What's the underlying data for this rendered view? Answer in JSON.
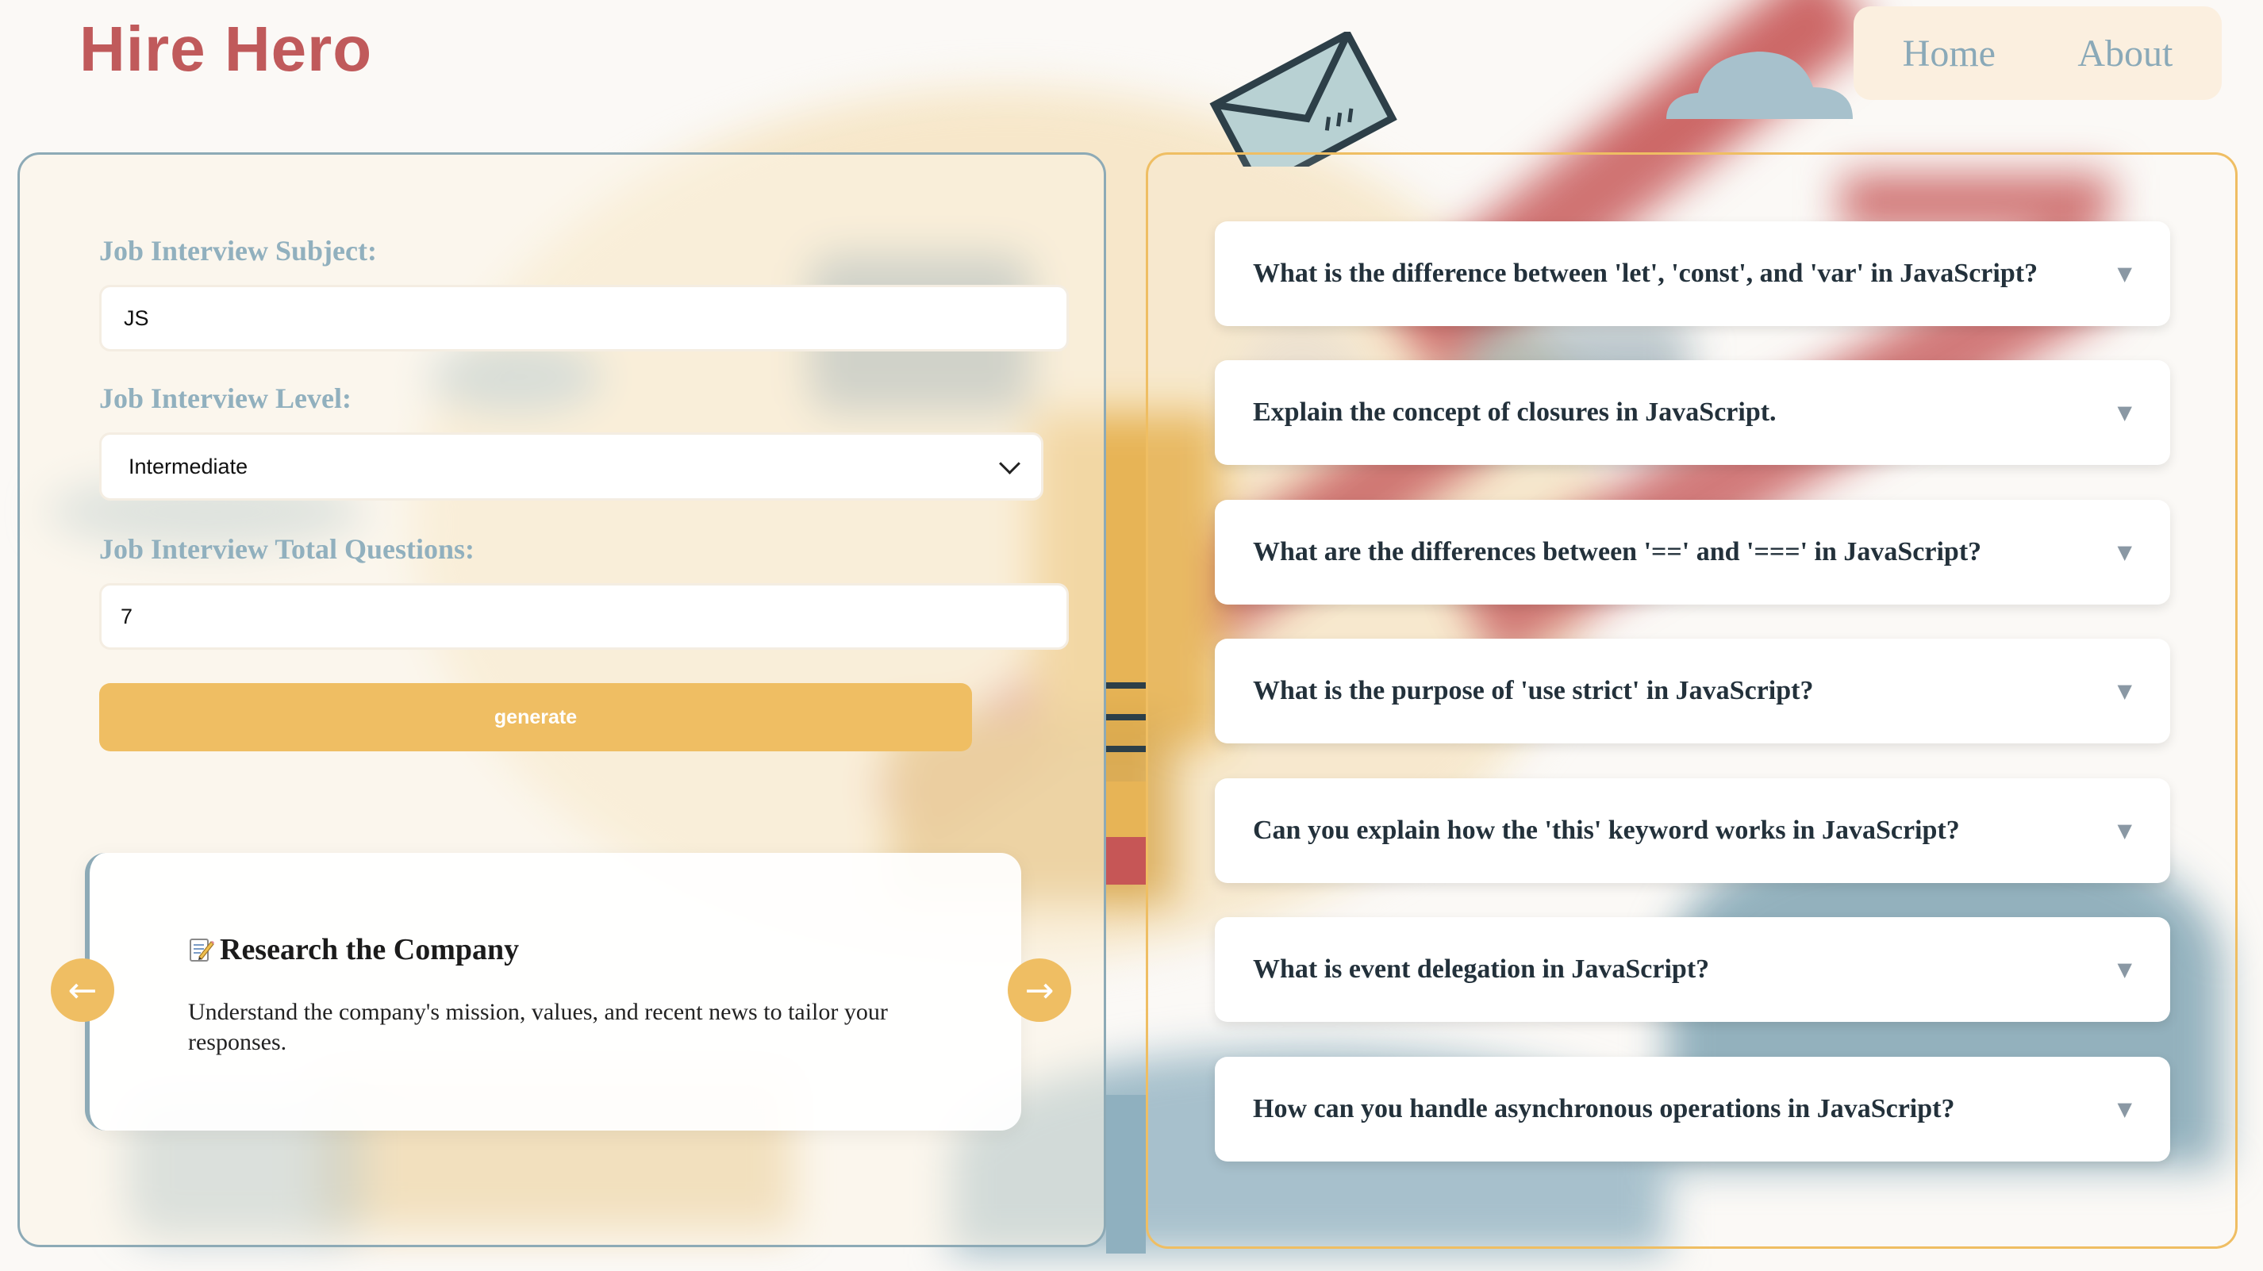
{
  "header": {
    "logo": "Hire Hero",
    "nav": [
      "Home",
      "About"
    ]
  },
  "form": {
    "subject_label": "Job Interview Subject:",
    "subject_value": "JS",
    "level_label": "Job Interview Level:",
    "level_value": "Intermediate",
    "total_label": "Job Interview Total Questions:",
    "total_value": "7",
    "generate_label": "generate"
  },
  "tip": {
    "icon": "memo-icon",
    "title": "Research the Company",
    "text": "Understand the company's mission, values, and recent news to tailor your responses.",
    "prev_arrow": "←",
    "next_arrow": "→"
  },
  "questions": [
    "What is the difference between 'let', 'const', and 'var' in JavaScript?",
    "Explain the concept of closures in JavaScript.",
    "What are the differences between '==' and '===' in JavaScript?",
    "What is the purpose of 'use strict' in JavaScript?",
    "Can you explain how the 'this' keyword works in JavaScript?",
    "What is event delegation in JavaScript?",
    "How can you handle asynchronous operations in JavaScript?"
  ],
  "question_caret": "▼",
  "colors": {
    "brand": "#c05a5b",
    "accent": "#efbe63",
    "muted_blue": "#8daab6",
    "nav_bg": "#fbefdf"
  }
}
